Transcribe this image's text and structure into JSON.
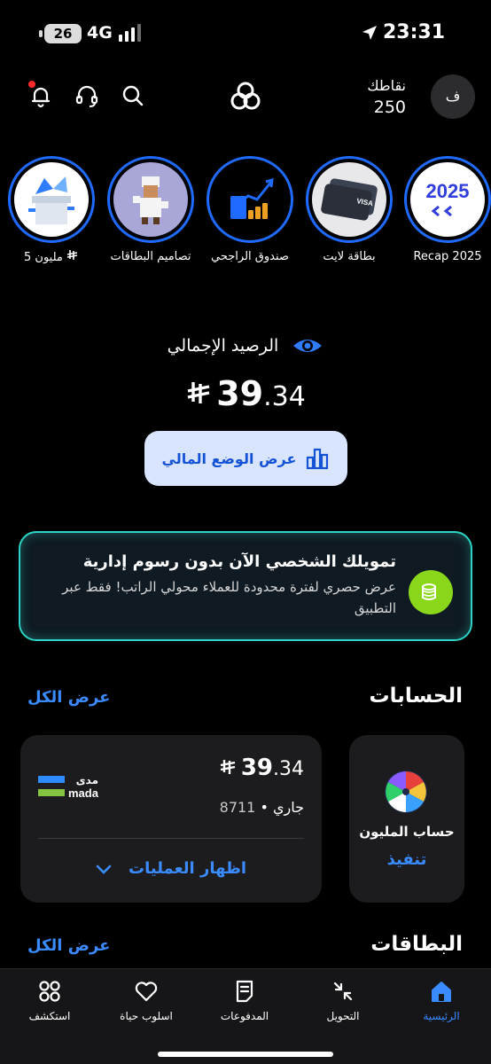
{
  "status_bar": {
    "time": "23:31",
    "battery": "26",
    "network": "4G"
  },
  "header": {
    "points_label": "نقاطك",
    "points_value": "250",
    "avatar_initial": "ف",
    "notification_badge_color": "#ff2b2b"
  },
  "stories": [
    {
      "label": "Recap 2025",
      "art_text": "2025"
    },
    {
      "label": "بطاقة لايت"
    },
    {
      "label": "صندوق الراجحي"
    },
    {
      "label": "تصاميم البطاقات"
    },
    {
      "label": "5 مليون"
    }
  ],
  "balance": {
    "title": "الرصيد الإجمالي",
    "amount_main": "39",
    "amount_decimal": ".34",
    "button_label": "عرض الوضع المالي"
  },
  "promo": {
    "title": "تمويلك الشخصي الآن بدون رسوم إدارية",
    "description": "عرض حصري لفترة محدودة للعملاء محولي الراتب! فقط عبر التطبيق"
  },
  "accounts": {
    "title": "الحسابات",
    "see_all": "عرض الكل",
    "million_account": {
      "name": "حساب المليون",
      "action": "تنفيذ"
    },
    "current_account": {
      "amount_main": "39",
      "amount_decimal": ".34",
      "type": "جاري",
      "separator": "•",
      "number": "8711",
      "show_transactions": "اظهار العمليات",
      "card_network": "mada",
      "card_network_ar": "مدى"
    }
  },
  "cards": {
    "title": "البطاقات",
    "see_all": "عرض الكل"
  },
  "nav": [
    {
      "label": "الرئيسية",
      "icon": "home-icon",
      "active": true
    },
    {
      "label": "التحويل",
      "icon": "transfer-icon",
      "active": false
    },
    {
      "label": "المدفوعات",
      "icon": "payments-icon",
      "active": false
    },
    {
      "label": "اسلوب حياة",
      "icon": "heart-icon",
      "active": false
    },
    {
      "label": "استكشف",
      "icon": "explore-icon",
      "active": false
    }
  ],
  "colors": {
    "accent": "#3a8bff",
    "story_ring": "#1f6bff",
    "promo_border": "#2bd4c4",
    "promo_icon": "#8ad61b"
  }
}
